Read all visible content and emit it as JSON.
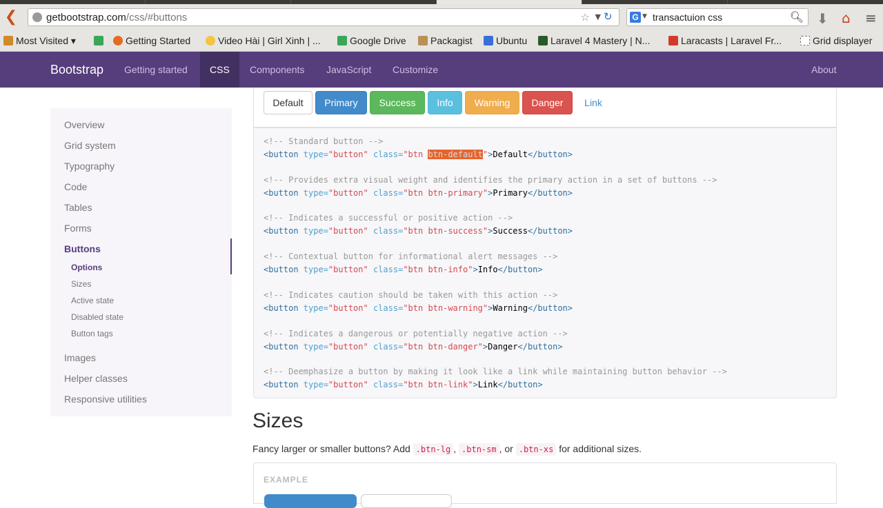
{
  "browser": {
    "url_host": "getbootstrap.com",
    "url_path": "/css/#buttons",
    "search_query": "transactuion css",
    "search_engine": "G"
  },
  "bookmarks": [
    {
      "label": "Most Visited ▾",
      "icon": "bookmark-folder-icon",
      "color": "#d08a2a"
    },
    {
      "label": "Getting Started",
      "icon": "firefox-icon",
      "color": "#e66a1f"
    },
    {
      "label": "Video Hài | Girl Xinh | ...",
      "icon": "smiley-icon",
      "color": "#f4c542"
    },
    {
      "label": "Google Drive",
      "icon": "drive-icon",
      "color": "#3aa757"
    },
    {
      "label": "Packagist",
      "icon": "folder-icon",
      "color": "#b99157"
    },
    {
      "label": "Ubuntu",
      "icon": "doc-icon",
      "color": "#3a6fd8"
    },
    {
      "label": "Laravel 4 Mastery | N...",
      "icon": "laravel-mastery-icon",
      "color": "#2a5a2a"
    },
    {
      "label": "Laracasts | Laravel Fr...",
      "icon": "laracasts-icon",
      "color": "#d33a2a"
    },
    {
      "label": "Grid displayer",
      "icon": "page-icon",
      "color": "#ffffff"
    }
  ],
  "site": {
    "brand": "Bootstrap",
    "nav": [
      "Getting started",
      "CSS",
      "Components",
      "JavaScript",
      "Customize"
    ],
    "nav_active": "CSS",
    "nav_right": "About"
  },
  "sidebar": {
    "items": [
      "Overview",
      "Grid system",
      "Typography",
      "Code",
      "Tables",
      "Forms",
      "Buttons"
    ],
    "active": "Buttons",
    "sub_items": [
      "Options",
      "Sizes",
      "Active state",
      "Disabled state",
      "Button tags"
    ],
    "sub_active": "Options",
    "items_after": [
      "Images",
      "Helper classes",
      "Responsive utilities"
    ]
  },
  "example_buttons": [
    "Default",
    "Primary",
    "Success",
    "Info",
    "Warning",
    "Danger",
    "Link"
  ],
  "code": {
    "comments": [
      "<!-- Standard button -->",
      "<!-- Provides extra visual weight and identifies the primary action in a set of buttons -->",
      "<!-- Indicates a successful or positive action -->",
      "<!-- Contextual button for informational alert messages -->",
      "<!-- Indicates caution should be taken with this action -->",
      "<!-- Indicates a dangerous or potentially negative action -->",
      "<!-- Deemphasize a button by making it look like a link while maintaining button behavior -->"
    ],
    "classes": [
      "btn-default",
      "btn-primary",
      "btn-success",
      "btn-info",
      "btn-warning",
      "btn-danger",
      "btn-link"
    ],
    "labels": [
      "Default",
      "Primary",
      "Success",
      "Info",
      "Warning",
      "Danger",
      "Link"
    ],
    "tag_open": "<button ",
    "attr_type": "type=",
    "val_type": "\"button\"",
    "attr_class": "class=",
    "class_prefix": "\"btn ",
    "tag_close_start": ">",
    "tag_end": "</button>"
  },
  "sizes": {
    "title": "Sizes",
    "text_before": "Fancy larger or smaller buttons? Add ",
    "code1": ".btn-lg",
    "sep1": ", ",
    "code2": ".btn-sm",
    "sep2": ", or ",
    "code3": ".btn-xs",
    "text_after": " for additional sizes.",
    "example_label": "EXAMPLE"
  },
  "colors": {
    "brand_purple": "#563d7c",
    "highlight": "#e8642c"
  }
}
